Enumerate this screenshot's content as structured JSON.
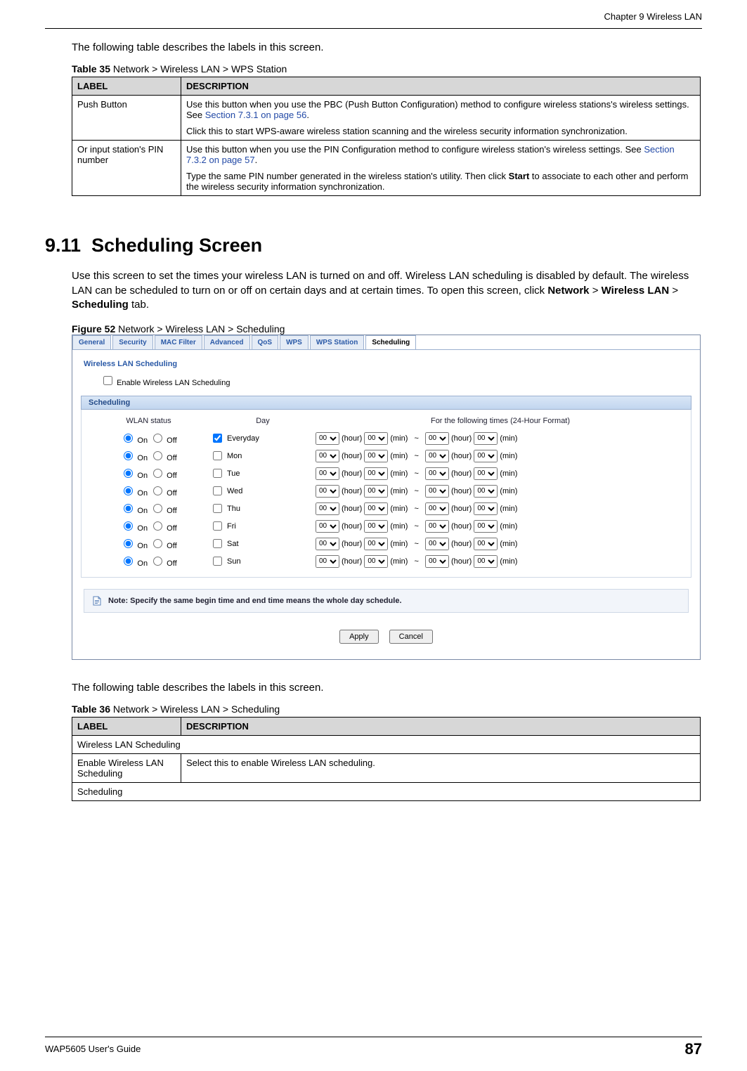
{
  "header": {
    "chapter": "Chapter 9 Wireless LAN"
  },
  "intro_t35": "The following table describes the labels in this screen.",
  "table35": {
    "caption_bold": "Table 35",
    "caption_rest": "   Network > Wireless LAN > WPS Station",
    "headers": {
      "label": "LABEL",
      "desc": "DESCRIPTION"
    },
    "rows": [
      {
        "label": "Push Button",
        "desc_part1": "Use this button when you use the PBC (Push Button Configuration) method to configure wireless stations's wireless settings. See ",
        "link1": "Section 7.3.1 on page 56",
        "desc_part2": ".",
        "desc_p2": "Click this to start WPS-aware wireless station scanning and the wireless security information synchronization."
      },
      {
        "label": "Or input station's PIN number",
        "desc_part1": "Use this button when you use the PIN Configuration method to configure wireless station's wireless settings. See ",
        "link1": "Section 7.3.2 on page 57",
        "desc_part2": ".",
        "desc_p2a": "Type the same PIN number generated in the wireless station's utility. Then click ",
        "desc_p2b_strong": "Start",
        "desc_p2c": " to associate to each other and perform the wireless security information synchronization."
      }
    ]
  },
  "section": {
    "number": "9.11",
    "title": "Scheduling Screen",
    "para_a": "Use this screen to set the times your wireless LAN is turned on and off. Wireless LAN scheduling is disabled by default. The wireless LAN can be scheduled to turn on or off on certain days and at certain times. To open this screen, click ",
    "para_b1": "Network",
    "para_gt1": " > ",
    "para_b2": "Wireless LAN",
    "para_gt2": " > ",
    "para_b3": "Scheduling",
    "para_end": " tab."
  },
  "figure52": {
    "caption_bold": "Figure 52",
    "caption_rest": "   Network > Wireless LAN > Scheduling"
  },
  "ui": {
    "tabs": [
      "General",
      "Security",
      "MAC Filter",
      "Advanced",
      "QoS",
      "WPS",
      "WPS Station",
      "Scheduling"
    ],
    "active_tab_index": 7,
    "section_title": "Wireless LAN Scheduling",
    "enable_label": "Enable Wireless LAN Scheduling",
    "subhead": "Scheduling",
    "cols": {
      "c1": "WLAN status",
      "c2": "Day",
      "c3": "For the following times (24-Hour Format)"
    },
    "on_label": "On",
    "off_label": "Off",
    "days": [
      "Everyday",
      "Mon",
      "Tue",
      "Wed",
      "Thu",
      "Fri",
      "Sat",
      "Sun"
    ],
    "days_checked": [
      true,
      false,
      false,
      false,
      false,
      false,
      false,
      false
    ],
    "time_val": "00",
    "hour_label": "(hour)",
    "min_label": "(min)",
    "tilde": "~",
    "note": "Note: Specify the same begin time and end time means the whole day schedule.",
    "apply": "Apply",
    "cancel": "Cancel"
  },
  "intro_t36": "The following table describes the labels in this screen.",
  "table36": {
    "caption_bold": "Table 36",
    "caption_rest": "   Network > Wireless LAN > Scheduling",
    "headers": {
      "label": "LABEL",
      "desc": "DESCRIPTION"
    },
    "span1": "Wireless LAN Scheduling",
    "row1": {
      "label": "Enable Wireless LAN Scheduling",
      "desc": "Select this to enable Wireless LAN scheduling."
    },
    "span2": "Scheduling"
  },
  "footer": {
    "guide": "WAP5605 User's Guide",
    "page": "87"
  }
}
